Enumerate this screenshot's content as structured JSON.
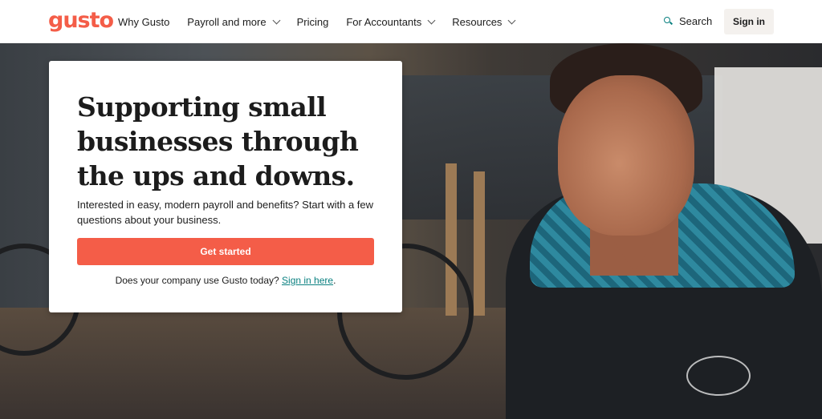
{
  "brand": {
    "logo_text": "gusto",
    "accent": "#f45d48",
    "link_color": "#0a8080"
  },
  "nav": {
    "items": [
      {
        "label": "Why Gusto",
        "has_dropdown": false
      },
      {
        "label": "Payroll and more",
        "has_dropdown": true
      },
      {
        "label": "Pricing",
        "has_dropdown": false
      },
      {
        "label": "For Accountants",
        "has_dropdown": true
      },
      {
        "label": "Resources",
        "has_dropdown": true
      }
    ],
    "search_label": "Search",
    "search_icon": "search-icon",
    "signin_label": "Sign in"
  },
  "hero": {
    "headline": "Supporting small businesses through the ups and downs.",
    "subtext": "Interested in easy, modern payroll and benefits? Start with a few questions about your business.",
    "cta_label": "Get started",
    "signin_prompt": "Does your company use Gusto today?",
    "signin_link": "Sign in here",
    "signin_suffix": "."
  }
}
